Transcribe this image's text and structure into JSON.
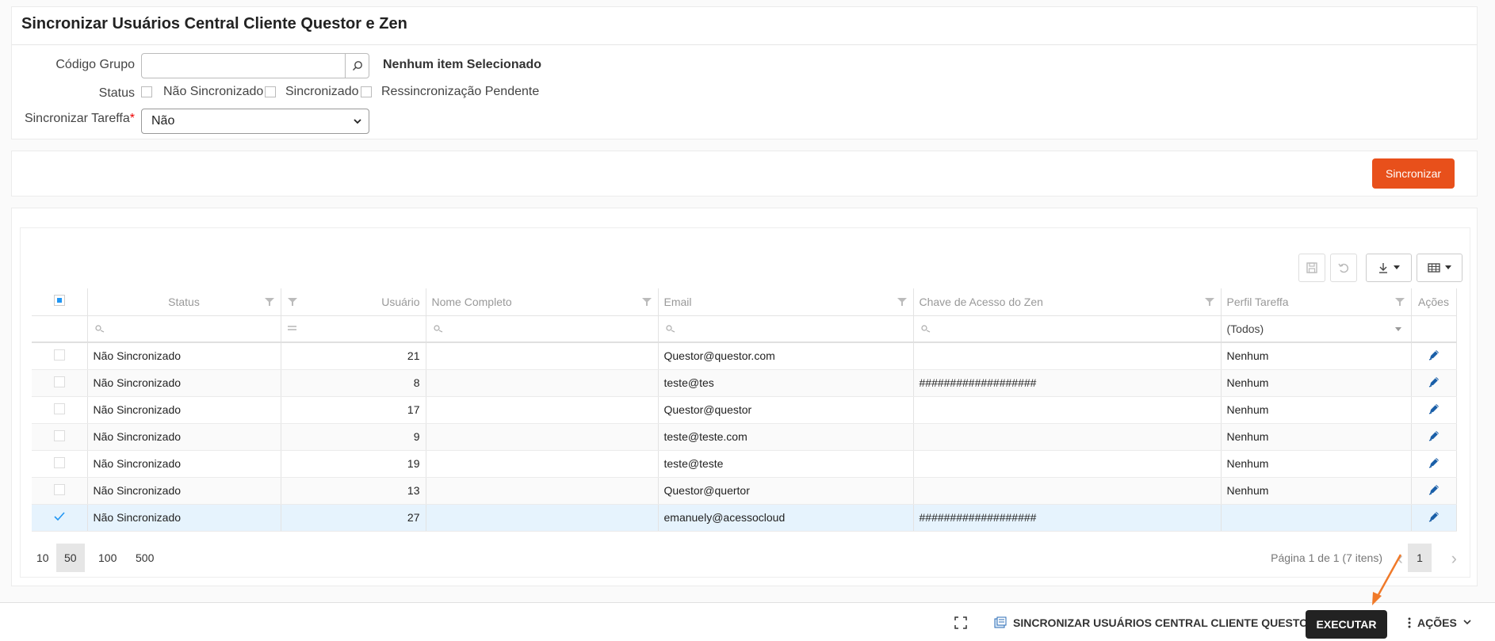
{
  "page": {
    "title": "Sincronizar Usuários Central Cliente Questor e Zen"
  },
  "filters": {
    "codigo_grupo_label": "Código Grupo",
    "codigo_grupo_value": "",
    "codigo_grupo_desc": "Nenhum item Selecionado",
    "status_label": "Status",
    "status_options": [
      "Não Sincronizado",
      "Sincronizado",
      "Ressincronização Pendente"
    ],
    "sincronizar_label": "Sincronizar Tareffa",
    "sincronizar_value": "Não"
  },
  "actions": {
    "sync_button": "Sincronizar"
  },
  "grid": {
    "columns": [
      "Status",
      "Usuário",
      "Nome Completo",
      "Email",
      "Chave de Acesso do Zen",
      "Perfil Tareffa",
      "Ações"
    ],
    "perfil_filter": "(Todos)",
    "rows": [
      {
        "status": "Não Sincronizado",
        "usuario": "21",
        "nome": "",
        "email": "Questor@questor.com",
        "chave": "",
        "perfil": "Nenhum",
        "selected": false
      },
      {
        "status": "Não Sincronizado",
        "usuario": "8",
        "nome": "",
        "email": "teste@tes",
        "chave": "###################",
        "perfil": "Nenhum",
        "selected": false
      },
      {
        "status": "Não Sincronizado",
        "usuario": "17",
        "nome": "",
        "email": "Questor@questor",
        "chave": "",
        "perfil": "Nenhum",
        "selected": false
      },
      {
        "status": "Não Sincronizado",
        "usuario": "9",
        "nome": "",
        "email": "teste@teste.com",
        "chave": "",
        "perfil": "Nenhum",
        "selected": false
      },
      {
        "status": "Não Sincronizado",
        "usuario": "19",
        "nome": "",
        "email": "teste@teste",
        "chave": "",
        "perfil": "Nenhum",
        "selected": false
      },
      {
        "status": "Não Sincronizado",
        "usuario": "13",
        "nome": "",
        "email": "Questor@quertor",
        "chave": "",
        "perfil": "Nenhum",
        "selected": false
      },
      {
        "status": "Não Sincronizado",
        "usuario": "27",
        "nome": "",
        "email": "emanuely@acessocloud",
        "chave": "###################",
        "perfil": "",
        "selected": true
      }
    ]
  },
  "pager": {
    "sizes": [
      "10",
      "50",
      "100",
      "500"
    ],
    "active_size": "50",
    "info": "Página 1 de 1 (7 itens)",
    "current_page": "1"
  },
  "footer": {
    "process_name": "SINCRONIZAR USUÁRIOS CENTRAL CLIENTE QUESTOR",
    "execute": "EXECUTAR",
    "actions": "AÇÕES"
  },
  "colors": {
    "accent": "#e8501b",
    "execute_bg": "#222222",
    "selected_row": "#e6f3fd",
    "edit_icon": "#1a5fa8"
  },
  "icons": [
    "search-icon",
    "filter-icon",
    "save-icon",
    "undo-icon",
    "download-icon",
    "columns-icon",
    "edit-icon",
    "expand-icon",
    "process-icon",
    "more-icon",
    "chevron-down-icon",
    "check-icon"
  ]
}
